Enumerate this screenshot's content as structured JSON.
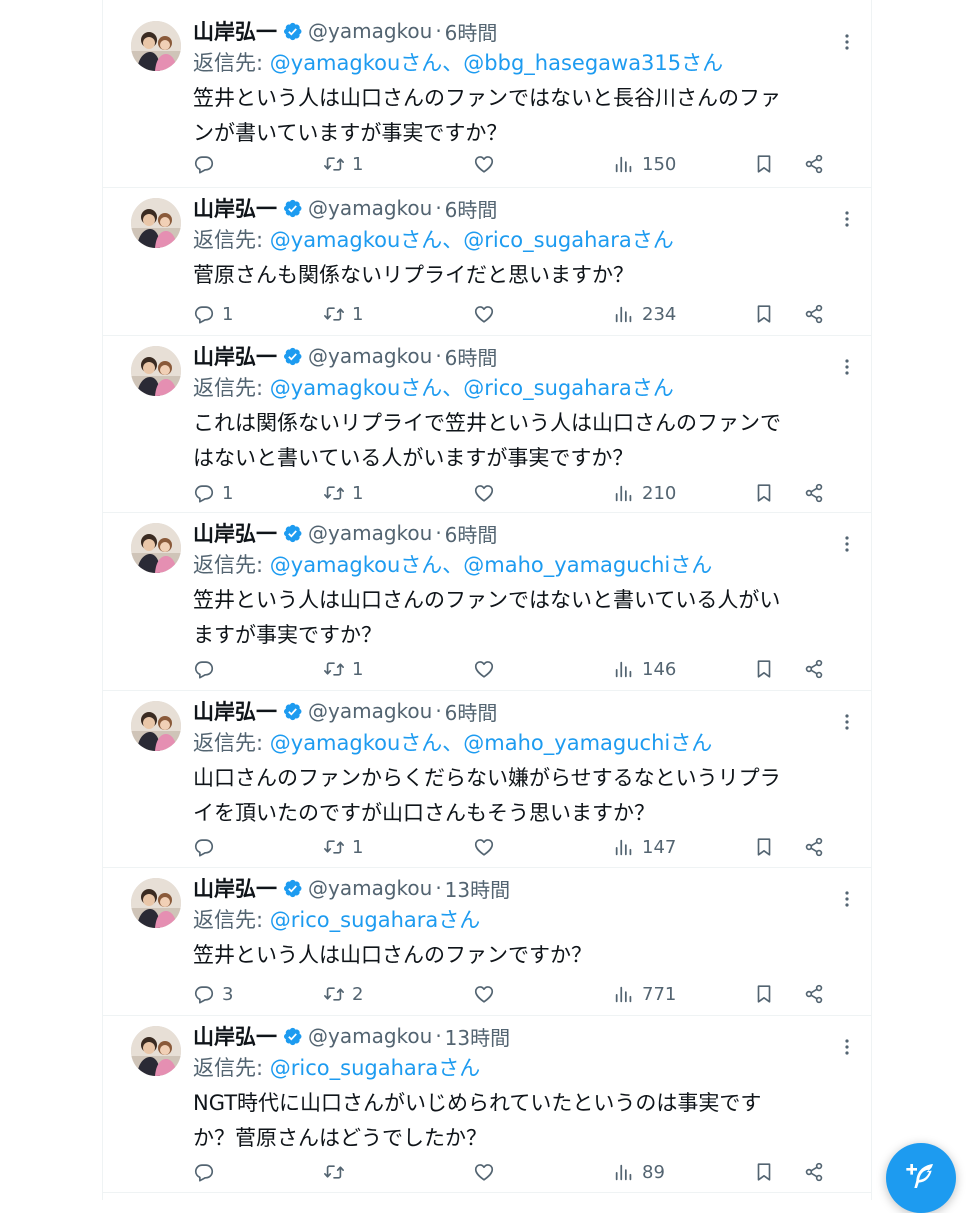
{
  "author": {
    "name": "山岸弘一",
    "handle": "@yamagkou",
    "sep": "·"
  },
  "reply_prefix": "返信先:",
  "tweets": [
    {
      "time": "6時間",
      "reply_to": "@yamagkouさん、@bbg_hasegawa315さん",
      "lines": [
        "笠井という人は山口さんのファンではないと長谷川さんのファ",
        "ンが書いていますが事実ですか？"
      ],
      "replies": "",
      "retweets": "1",
      "views": "150"
    },
    {
      "time": "6時間",
      "reply_to": "@yamagkouさん、@rico_sugaharaさん",
      "lines": [
        "菅原さんも関係ないリプライだと思いますか？"
      ],
      "replies": "1",
      "retweets": "1",
      "views": "234"
    },
    {
      "time": "6時間",
      "reply_to": "@yamagkouさん、@rico_sugaharaさん",
      "lines": [
        "これは関係ないリプライで笠井という人は山口さんのファンで",
        "はないと書いている人がいますが事実ですか？"
      ],
      "replies": "1",
      "retweets": "1",
      "views": "210"
    },
    {
      "time": "6時間",
      "reply_to": "@yamagkouさん、@maho_yamaguchiさん",
      "lines": [
        "笠井という人は山口さんのファンではないと書いている人がい",
        "ますが事実ですか？"
      ],
      "replies": "",
      "retweets": "1",
      "views": "146"
    },
    {
      "time": "6時間",
      "reply_to": "@yamagkouさん、@maho_yamaguchiさん",
      "lines": [
        "山口さんのファンからくだらない嫌がらせするなというリプラ",
        "イを頂いたのですが山口さんもそう思いますか？"
      ],
      "replies": "",
      "retweets": "1",
      "views": "147"
    },
    {
      "time": "13時間",
      "reply_to": "@rico_sugaharaさん",
      "lines": [
        "笠井という人は山口さんのファンですか？"
      ],
      "replies": "3",
      "retweets": "2",
      "views": "771"
    },
    {
      "time": "13時間",
      "reply_to": "@rico_sugaharaさん",
      "lines": [
        "NGT時代に山口さんがいじめられていたというのは事実です",
        "か？菅原さんはどうでしたか？"
      ],
      "replies": "",
      "retweets": "",
      "views": "89"
    }
  ],
  "icons": {
    "verified": "verified-badge-icon",
    "more": "more-dots-icon",
    "reply": "reply-icon",
    "retweet": "retweet-icon",
    "like": "heart-icon",
    "views": "views-chart-icon",
    "bookmark": "bookmark-icon",
    "share": "share-icon",
    "compose": "compose-icon"
  },
  "colors": {
    "accent": "#1d9bf0",
    "text": "#0f1419",
    "muted": "#536471",
    "border": "#eff3f4"
  }
}
